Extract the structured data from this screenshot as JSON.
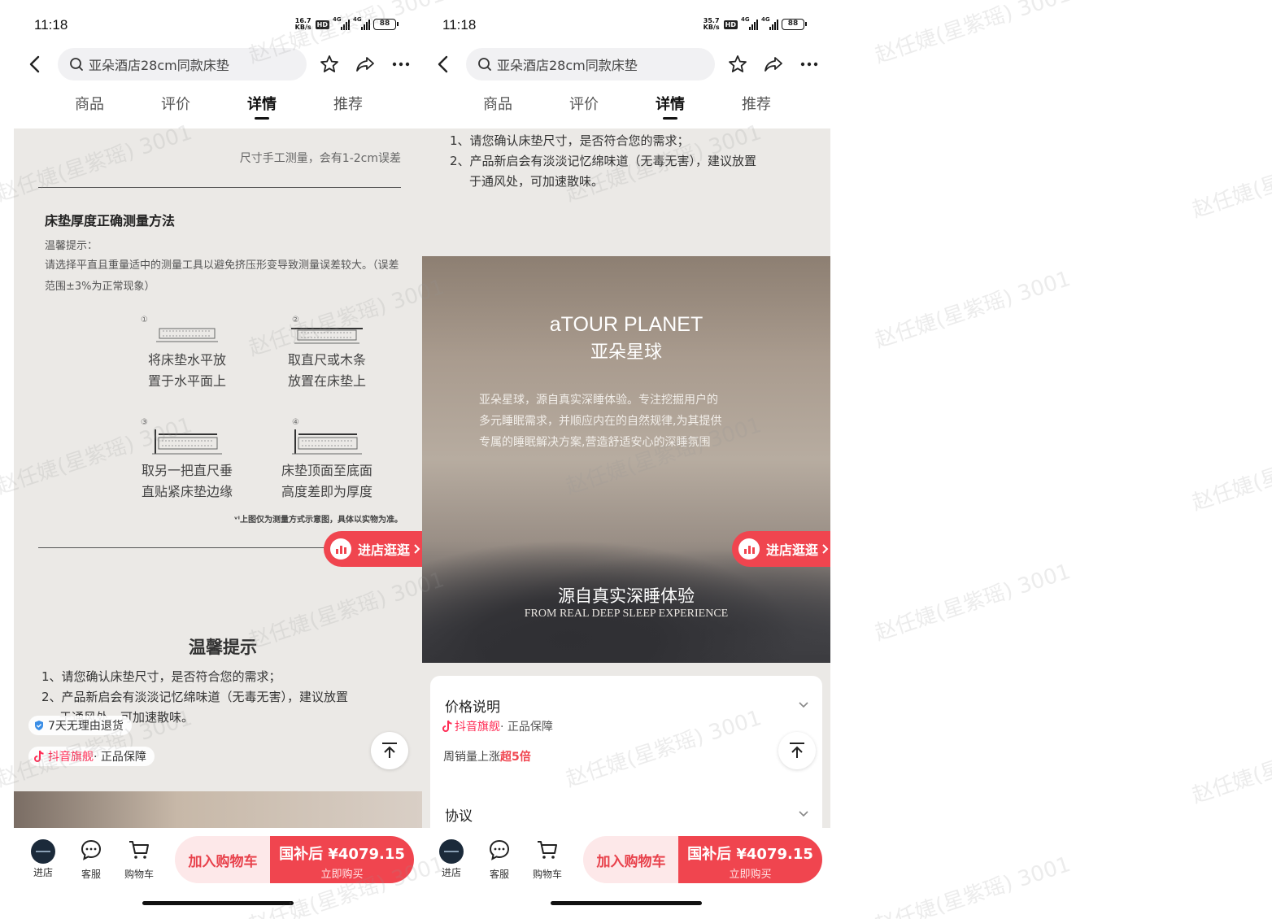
{
  "status_bar": {
    "time": "11:18",
    "left_speed_value": "16.7",
    "right_speed_value": "35.7",
    "speed_unit": "KB/s",
    "hd": "HD",
    "net_type": "4G",
    "battery": "88"
  },
  "top_bar": {
    "search_text": "亚朵酒店28cm同款床垫"
  },
  "tabs": [
    {
      "label": "商品"
    },
    {
      "label": "评价"
    },
    {
      "label": "详情"
    },
    {
      "label": "推荐"
    }
  ],
  "left_content": {
    "size_note": "尺寸手工测量，会有1-2cm误差",
    "measure_heading": "床垫厚度正确测量方法",
    "tip_label": "温馨提示：",
    "tip_text": "请选择平直且重量适中的测量工具以避免挤压形变导致测量误差较大。（误差范围±3%为正常现象）",
    "steps": [
      {
        "num": "①",
        "line1": "将床垫水平放",
        "line2": "置于水平面上"
      },
      {
        "num": "②",
        "line1": "取直尺或木条",
        "line2": "放置在床垫上"
      },
      {
        "num": "③",
        "line1": "取另一把直尺垂",
        "line2": "直贴紧床垫边缘"
      },
      {
        "num": "④",
        "line1": "床垫顶面至底面",
        "line2": "高度差即为厚度"
      }
    ],
    "footnote": "ᵛᴵ上图仅为测量方式示意图，具体以实物为准。",
    "tips_title": "温馨提示",
    "tips": [
      "1、请您确认床垫尺寸，是否符合您的需求；",
      "2、产品新启会有淡淡记忆绵味道（无毒无害），建议放置",
      "于通风处，可加速散味。"
    ],
    "return_badge": "7天无理由退货",
    "brand_badge_name": "抖音旗舰",
    "brand_badge_suffix": " · 正品保障"
  },
  "shop_button": "进店逛逛",
  "right_content": {
    "tips": [
      "1、请您确认床垫尺寸，是否符合您的需求；",
      "2、产品新启会有淡淡记忆绵味道（无毒无害），建议放置",
      "于通风处，可加速散味。"
    ],
    "logo_en": "aTOUR PLANET",
    "logo_cn": "亚朵星球",
    "description": [
      "亚朵星球，源自真实深睡体验。专注挖掘用户的",
      "多元睡眠需求，并顺应内在的自然规律,为其提供",
      "专属的睡眠解决方案,营造舒适安心的深睡氛围"
    ],
    "slogan": "源自真实深睡体验",
    "slogan_en": "FROM REAL DEEP SLEEP EXPERIENCE",
    "price_section_title": "价格说明",
    "brand_name": "抖音旗舰",
    "brand_suffix": " · 正品保障",
    "sales_prefix": "周销量上涨",
    "sales_highlight": "超5倍",
    "agreement_title": "协议"
  },
  "bottom_bar": {
    "store_label": "进店",
    "service_label": "客服",
    "cart_label": "购物车",
    "add_cart_button": "加入购物车",
    "buy_price": "国补后 ¥4079.15",
    "buy_sub": "立即购买"
  },
  "watermark": "赵任婕(星紫瑶) 3001",
  "colors": {
    "accent_red": "#f0454f",
    "douyin_red": "#ff2c55",
    "content_bg": "#ebe9e6"
  }
}
